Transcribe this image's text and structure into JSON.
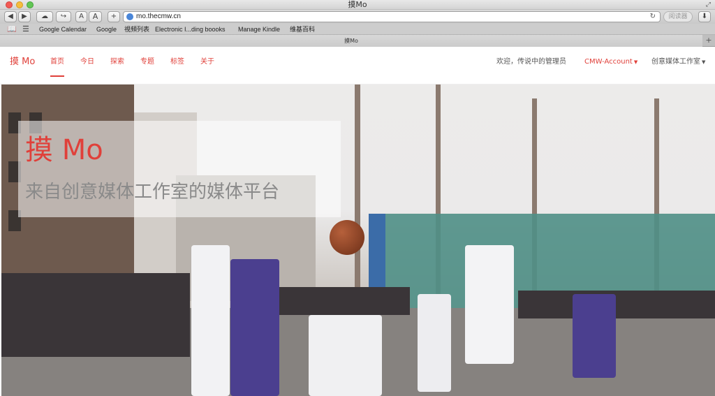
{
  "window": {
    "title": "摸Mo"
  },
  "toolbar": {
    "back": "◀",
    "forward": "▶",
    "cloud": "☁",
    "share": "↪",
    "font_small": "A",
    "font_large": "A",
    "add": "+",
    "address": "mo.thecmw.cn",
    "reload": "↻",
    "reader": "阅读器",
    "download": "⬇"
  },
  "bookmarks": [
    "Google Calendar",
    "Google",
    "視頻列表",
    "Electronic I...ding boooks",
    "Manage Kindle",
    "维基百科"
  ],
  "tab": {
    "label": "摸Mo",
    "new": "+"
  },
  "nav": {
    "brand": "摸 Mo",
    "items": [
      "首页",
      "今日",
      "探索",
      "专题",
      "标签",
      "关于"
    ],
    "welcome": "欢迎，传说中的管理员",
    "account": "CMW-Account",
    "studio": "创意媒体工作室"
  },
  "hero": {
    "title": "摸 Mo",
    "subtitle": "来自创意媒体工作室的媒体平台"
  },
  "colors": {
    "accent": "#e0403a"
  }
}
